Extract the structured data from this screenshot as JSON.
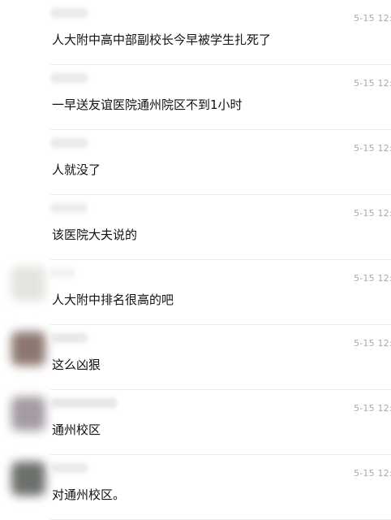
{
  "comments": [
    {
      "time": "5-15 12:3",
      "text": "人大附中高中部副校长今早被学生扎死了",
      "avatar": false,
      "name_color": "#e9e9e9",
      "name_width": "short"
    },
    {
      "time": "5-15 12:3",
      "text": "一早送友谊医院通州院区不到1小时",
      "avatar": false,
      "name_color": "#e9e9e9",
      "name_width": "short"
    },
    {
      "time": "5-15 12:3",
      "text": "人就没了",
      "avatar": false,
      "name_color": "#e9e9e9",
      "name_width": "short"
    },
    {
      "time": "5-15 12:3",
      "text": "该医院大夫说的",
      "avatar": false,
      "name_color": "#ececec",
      "name_width": "short"
    },
    {
      "time": "5-15 12:3",
      "text": "人大附中排名很高的吧",
      "avatar": true,
      "avatar_color": "#e2e4de",
      "name_color": "#f1f1f1",
      "name_width": "tiny"
    },
    {
      "time": "5-15 12:5",
      "text": "这么凶狠",
      "avatar": true,
      "avatar_color": "#8d7771",
      "name_color": "#e8e8e8",
      "name_width": "short"
    },
    {
      "time": "5-15 12:3",
      "text": "通州校区",
      "avatar": true,
      "avatar_color": "#a49ba3",
      "name_color": "#e6e6e6",
      "name_width": "long"
    },
    {
      "time": "5-15 12:5",
      "text": "对通州校区。",
      "avatar": true,
      "avatar_color": "#6d706c",
      "name_color": "#e9e9e9",
      "name_width": "short"
    }
  ]
}
